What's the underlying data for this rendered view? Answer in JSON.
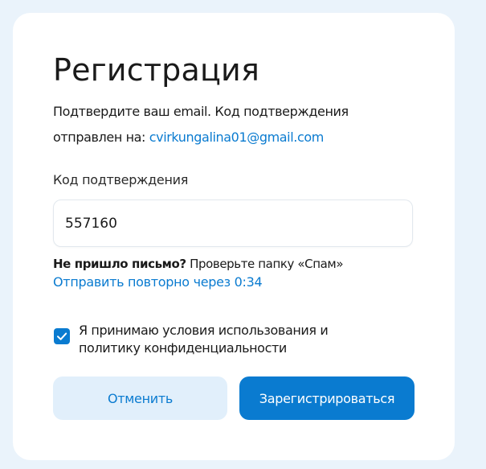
{
  "form": {
    "title": "Регистрация",
    "description_prefix": "Подтвердите ваш email. Код подтверждения отправлен на: ",
    "email": "cvirkungalina01@gmail.com",
    "code_label": "Код подтверждения",
    "code_value": "557160",
    "no_email_bold": "Не пришло письмо?",
    "no_email_hint": " Проверьте папку «Спам»",
    "resend_text": "Отправить повторно через 0:34",
    "terms_checked": true,
    "terms_text": "Я принимаю условия использования и политику конфиденциальности",
    "cancel_label": "Отменить",
    "register_label": "Зарегистрироваться"
  },
  "colors": {
    "accent": "#0a7bd0",
    "accent_light": "#e1effb",
    "background": "#eaf3fb"
  },
  "icons": {
    "checkbox": "checkmark-icon"
  }
}
